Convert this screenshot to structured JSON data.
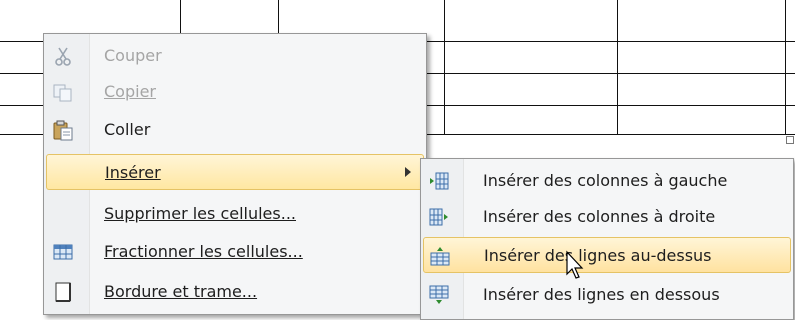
{
  "context_menu": {
    "items": [
      {
        "label": "Couper",
        "icon": "scissors-icon",
        "disabled": true
      },
      {
        "label": "Copier",
        "icon": "copy-icon",
        "disabled": true
      },
      {
        "label": "Coller",
        "icon": "paste-icon",
        "disabled": false
      },
      {
        "label": "Insérer",
        "icon": "",
        "disabled": false,
        "highlighted": true,
        "has_submenu": true
      },
      {
        "label": "Supprimer les cellules...",
        "icon": "",
        "disabled": false
      },
      {
        "label": "Fractionner les cellules...",
        "icon": "split-cells-icon",
        "disabled": false
      },
      {
        "label": "Bordure et trame...",
        "icon": "border-icon",
        "disabled": false
      }
    ]
  },
  "insert_submenu": {
    "items": [
      {
        "label": "Insérer des colonnes à gauche",
        "icon": "insert-column-left-icon"
      },
      {
        "label": "Insérer des colonnes à droite",
        "icon": "insert-column-right-icon"
      },
      {
        "label": "Insérer des lignes au-dessus",
        "icon": "insert-row-above-icon",
        "highlighted": true
      },
      {
        "label": "Insérer des lignes en dessous",
        "icon": "insert-row-below-icon"
      }
    ]
  },
  "colors": {
    "highlight_top": "#fff5d7",
    "highlight_bottom": "#ffe7a2",
    "highlight_border": "#e5c365",
    "menu_background": "#f5f6f7",
    "disabled_text": "#a5a5a5"
  }
}
